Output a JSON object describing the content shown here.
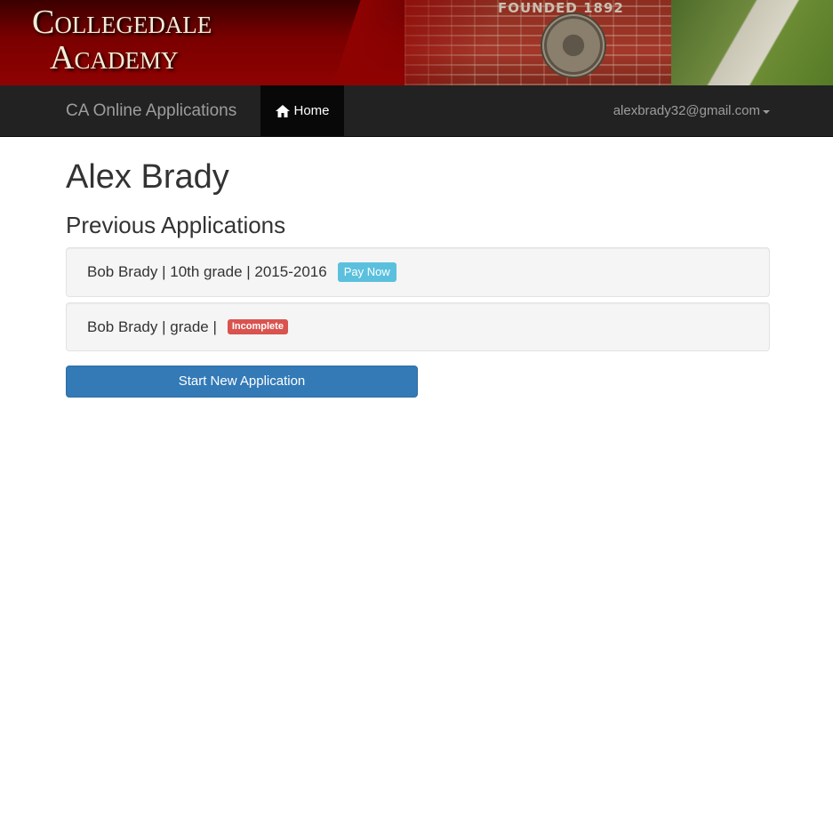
{
  "banner": {
    "logo_line1": "Collegedale",
    "logo_line2": "Academy",
    "photo_caption": "FOUNDED  1892"
  },
  "navbar": {
    "brand": "CA Online Applications",
    "home_label": "Home",
    "home_icon": "home-icon",
    "account_email": "alexbrady32@gmail.com",
    "background_color": "#222222",
    "active_bg_color": "#080808"
  },
  "main": {
    "user_name": "Alex Brady",
    "section_title": "Previous Applications",
    "applications": [
      {
        "summary": "Bob Brady | 10th grade | 2015-2016",
        "status_label": "Pay Now",
        "status_color": "#5bc0de"
      },
      {
        "summary": "Bob Brady | grade |",
        "status_label": "Incomplete",
        "status_color": "#d9534f"
      }
    ],
    "new_application_button": "Start New Application",
    "button_color": "#337ab7"
  }
}
